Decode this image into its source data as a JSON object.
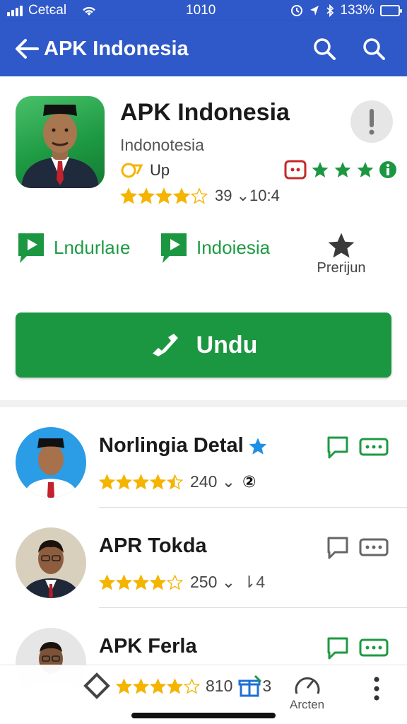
{
  "status_bar": {
    "carrier": "Cetєal",
    "time": "1010",
    "battery": "133%"
  },
  "app_bar": {
    "title": "APK Indonesia",
    "back_icon": "arrow-left-icon",
    "action_icons": [
      "search-icon",
      "search-icon"
    ]
  },
  "app": {
    "name": "APK Indonesia",
    "developer": "Indonotesia",
    "update_label": "Up",
    "rating_count": "39 ⌄10:4",
    "rating_stars": 4,
    "meta": [
      {
        "label": "Lndurlaıe",
        "icon": "play-chat-icon"
      },
      {
        "label": "Indoiesia",
        "icon": "play-chat-icon"
      }
    ],
    "premium_label": "Prerijun",
    "install_label": "Undu"
  },
  "list": [
    {
      "title": "Norlingia Detal",
      "rating": 4.5,
      "count": "240 ⌄",
      "suffix": "②",
      "verified": true,
      "accent": "#1e9a43"
    },
    {
      "title": "APR Tokda",
      "rating": 4,
      "count": "250 ⌄",
      "suffix": "⇂4",
      "verified": false,
      "accent": "#666666"
    },
    {
      "title": "APK Ferla",
      "rating": 4,
      "count": "810",
      "suffix": "3",
      "verified": false,
      "accent": "#1e9a43"
    }
  ],
  "bottom_nav": {
    "center_label": "Arcten"
  },
  "colors": {
    "primary": "#2f58c9",
    "green": "#1c9741",
    "star": "#f4b400"
  }
}
